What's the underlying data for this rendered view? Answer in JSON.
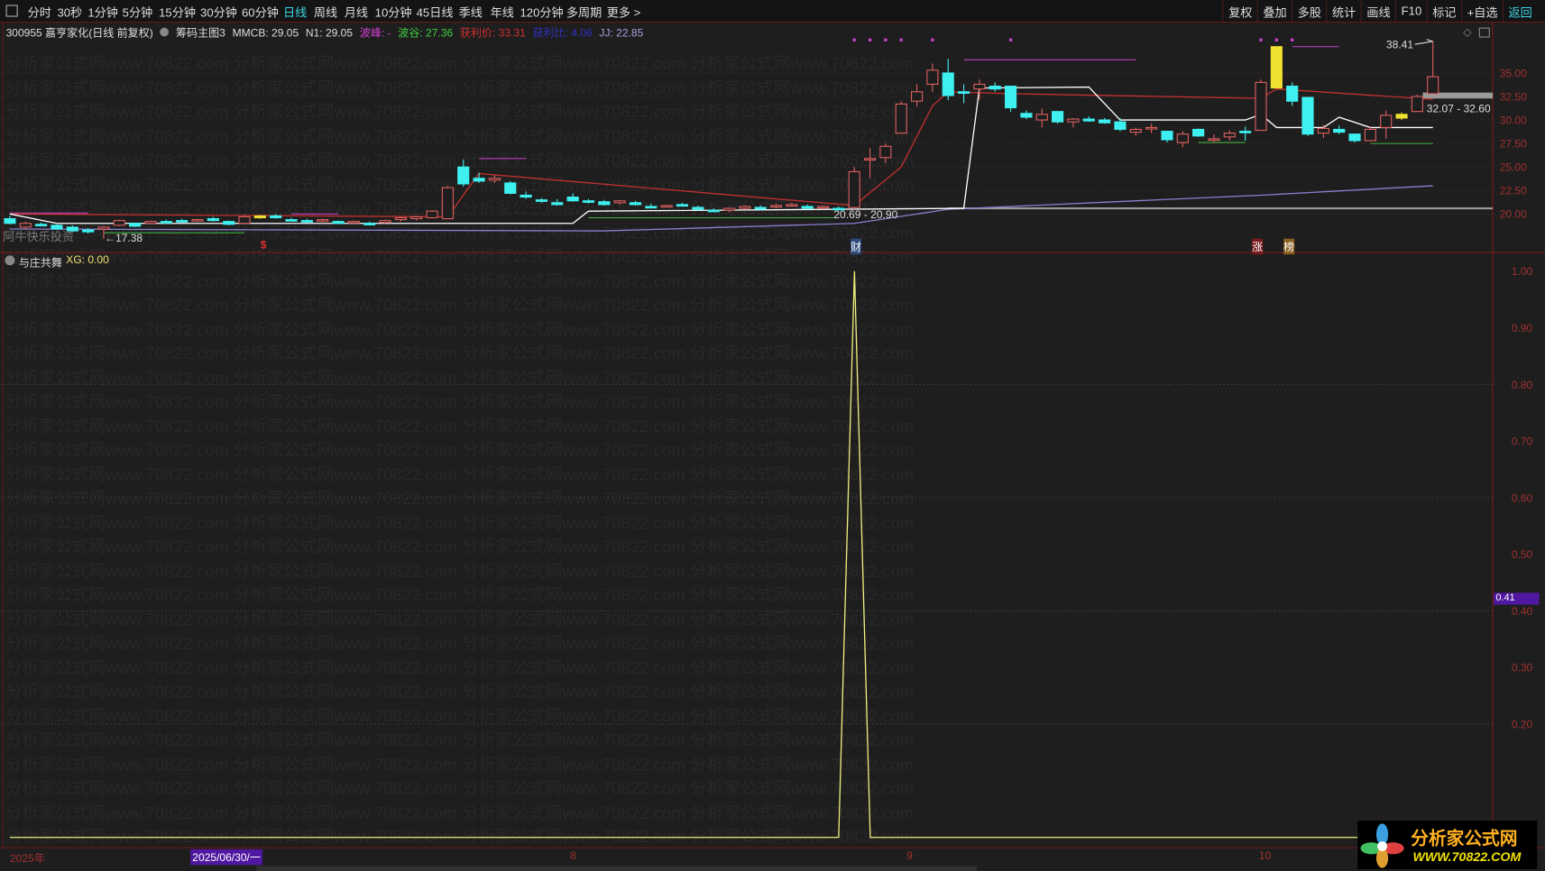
{
  "toolbar": {
    "periods": [
      "分时",
      "30秒",
      "1分钟",
      "5分钟",
      "15分钟",
      "30分钟",
      "60分钟",
      "日线",
      "周线",
      "月线",
      "10分钟",
      "45日线",
      "季线",
      "年线",
      "120分钟",
      "多周期",
      "更多 >"
    ],
    "active": "日线",
    "right": [
      "复权",
      "叠加",
      "多股",
      "统计",
      "画线",
      "F10",
      "标记",
      "+自选",
      "返回"
    ]
  },
  "info": {
    "stock": "300955 嘉亨家化(日线 前复权)",
    "indicator": "筹码主图3",
    "mmcb": "MMCB: 29.05",
    "n1": "N1: 29.05",
    "peak": "波峰: -",
    "valley": "波谷: 27.36",
    "profit_price": "获利价: 33.31",
    "profit_ratio": "获利比: 4.06",
    "jj": "JJ: 22.85"
  },
  "colors": {
    "up": "#e06060",
    "down": "#3ff0f0",
    "ma": "#c03030",
    "line": "#ffffff",
    "avg": "#8a80d0",
    "accent": "#3cd6e6",
    "yellow": "#f0e030"
  },
  "price_axis": [
    "35.00",
    "32.50",
    "30.00",
    "27.50",
    "25.00",
    "22.50",
    "20.00"
  ],
  "price_labels": {
    "low": "←17.38",
    "range1": "20.69 - 20.90",
    "high": "38.41",
    "range2": "32.07 - 32.60",
    "brand": "阿牛快乐投资"
  },
  "markers": {
    "dollar": "$",
    "cai": "财",
    "zhang": "涨",
    "bang": "榜"
  },
  "watermark": "分析家公式网www.70822.com",
  "lower": {
    "title": "与庄共舞",
    "xg": "XG: 0.00",
    "axis": [
      "1.00",
      "0.90",
      "0.80",
      "0.70",
      "0.60",
      "0.50",
      "0.40",
      "0.30",
      "0.20"
    ],
    "current": "0.41"
  },
  "dates": {
    "year": "2025年",
    "cursor": "2025/06/30/一",
    "m8": "8",
    "m9": "9",
    "m10": "10"
  },
  "logo": {
    "cn": "分析家公式网",
    "url": "WWW.70822.COM"
  },
  "chart_data": {
    "type": "candlestick",
    "ohlc": [
      [
        19.5,
        19.8,
        18.9,
        19.0
      ],
      [
        18.6,
        19.2,
        18.4,
        19.0
      ],
      [
        18.9,
        19.1,
        18.7,
        18.8
      ],
      [
        18.8,
        18.9,
        18.3,
        18.4
      ],
      [
        18.6,
        18.8,
        18.1,
        18.2
      ],
      [
        18.3,
        18.5,
        17.9,
        18.1
      ],
      [
        18.4,
        18.7,
        17.38,
        18.6
      ],
      [
        18.8,
        19.4,
        18.7,
        19.3
      ],
      [
        19.0,
        19.1,
        18.6,
        18.7
      ],
      [
        19.0,
        19.3,
        18.9,
        19.2
      ],
      [
        19.2,
        19.4,
        19.0,
        19.1
      ],
      [
        19.3,
        19.5,
        19.1,
        19.2
      ],
      [
        19.3,
        19.5,
        19.2,
        19.4
      ],
      [
        19.5,
        19.7,
        19.2,
        19.3
      ],
      [
        19.2,
        19.3,
        18.8,
        18.9
      ],
      [
        19.0,
        19.9,
        18.9,
        19.7
      ],
      [
        19.6,
        19.9,
        19.5,
        19.8
      ],
      [
        19.8,
        20.0,
        19.5,
        19.6
      ],
      [
        19.4,
        19.6,
        19.2,
        19.3
      ],
      [
        19.3,
        19.5,
        19.1,
        19.2
      ],
      [
        19.3,
        19.5,
        19.0,
        19.4
      ],
      [
        19.2,
        19.3,
        18.9,
        19.0
      ],
      [
        19.1,
        19.3,
        18.9,
        19.2
      ],
      [
        19.0,
        19.2,
        18.8,
        18.9
      ],
      [
        19.1,
        19.4,
        18.9,
        19.3
      ],
      [
        19.4,
        19.7,
        19.2,
        19.6
      ],
      [
        19.5,
        19.8,
        19.3,
        19.7
      ],
      [
        19.6,
        20.4,
        19.5,
        20.3
      ],
      [
        19.5,
        23.0,
        19.5,
        22.8
      ],
      [
        25.0,
        25.8,
        22.9,
        23.2
      ],
      [
        23.8,
        24.4,
        23.3,
        23.5
      ],
      [
        23.6,
        24.1,
        23.3,
        23.8
      ],
      [
        23.3,
        23.5,
        22.1,
        22.2
      ],
      [
        22.0,
        22.4,
        21.6,
        21.8
      ],
      [
        21.5,
        21.7,
        21.2,
        21.4
      ],
      [
        21.2,
        21.6,
        20.9,
        21.0
      ],
      [
        21.8,
        22.2,
        21.3,
        21.4
      ],
      [
        21.4,
        21.6,
        21.1,
        21.3
      ],
      [
        21.3,
        21.5,
        20.9,
        21.0
      ],
      [
        21.2,
        21.5,
        21.0,
        21.4
      ],
      [
        21.2,
        21.4,
        20.9,
        21.0
      ],
      [
        20.8,
        21.1,
        20.6,
        20.7
      ],
      [
        20.8,
        21.0,
        20.7,
        20.9
      ],
      [
        21.0,
        21.2,
        20.8,
        20.9
      ],
      [
        20.7,
        20.9,
        20.4,
        20.5
      ],
      [
        20.4,
        20.6,
        20.2,
        20.3
      ],
      [
        20.4,
        20.7,
        20.2,
        20.6
      ],
      [
        20.6,
        20.9,
        20.5,
        20.8
      ],
      [
        20.7,
        20.9,
        20.4,
        20.6
      ],
      [
        20.8,
        21.1,
        20.6,
        20.9
      ],
      [
        20.9,
        21.2,
        20.8,
        21.0
      ],
      [
        20.8,
        21.0,
        20.5,
        20.6
      ],
      [
        20.7,
        20.9,
        20.5,
        20.8
      ],
      [
        20.6,
        20.8,
        20.4,
        20.5
      ],
      [
        20.69,
        25.0,
        20.5,
        24.5
      ],
      [
        25.8,
        27.0,
        23.8,
        25.9
      ],
      [
        26.0,
        27.5,
        25.4,
        27.2
      ],
      [
        28.6,
        32.0,
        28.6,
        31.7
      ],
      [
        32.0,
        33.8,
        31.4,
        33.0
      ],
      [
        33.8,
        36.0,
        33.0,
        35.3
      ],
      [
        35.0,
        36.5,
        32.1,
        32.6
      ],
      [
        33.0,
        33.8,
        31.8,
        32.9
      ],
      [
        33.3,
        34.3,
        32.1,
        33.8
      ],
      [
        33.6,
        34.0,
        33.0,
        33.3
      ],
      [
        33.6,
        33.6,
        30.9,
        31.3
      ],
      [
        30.7,
        31.0,
        30.1,
        30.3
      ],
      [
        30.0,
        31.2,
        29.2,
        30.6
      ],
      [
        30.9,
        30.9,
        29.6,
        29.8
      ],
      [
        29.8,
        30.2,
        29.2,
        30.1
      ],
      [
        30.1,
        30.4,
        29.8,
        29.9
      ],
      [
        30.0,
        30.2,
        29.6,
        29.7
      ],
      [
        29.8,
        30.2,
        28.8,
        29.0
      ],
      [
        28.7,
        29.2,
        28.3,
        29.0
      ],
      [
        29.2,
        29.6,
        28.6,
        29.2
      ],
      [
        28.8,
        28.8,
        27.6,
        27.9
      ],
      [
        27.6,
        28.8,
        27.1,
        28.5
      ],
      [
        29.0,
        29.1,
        28.2,
        28.3
      ],
      [
        27.9,
        28.5,
        27.6,
        28.0
      ],
      [
        28.2,
        28.9,
        27.8,
        28.6
      ],
      [
        28.8,
        29.3,
        27.8,
        28.7
      ],
      [
        28.9,
        34.3,
        28.9,
        34.0
      ],
      [
        37.8,
        37.8,
        33.4,
        33.4
      ],
      [
        33.6,
        34.0,
        31.5,
        32.0
      ],
      [
        32.4,
        32.4,
        28.3,
        28.5
      ],
      [
        28.6,
        29.5,
        28.1,
        29.1
      ],
      [
        29.0,
        29.4,
        28.5,
        28.7
      ],
      [
        28.5,
        28.5,
        27.6,
        27.8
      ],
      [
        27.8,
        29.3,
        27.8,
        29.0
      ],
      [
        29.2,
        31.0,
        28.0,
        30.5
      ],
      [
        30.2,
        30.8,
        30.0,
        30.6
      ],
      [
        30.9,
        32.7,
        30.9,
        32.5
      ],
      [
        32.8,
        38.41,
        32.8,
        34.6
      ]
    ],
    "yellow_candles": [
      16,
      81,
      89
    ],
    "ma_line": [
      [
        0,
        20
      ],
      [
        28,
        19.7
      ],
      [
        30,
        24.3
      ],
      [
        54,
        20.9
      ],
      [
        57,
        25
      ],
      [
        59,
        31.5
      ],
      [
        60,
        33
      ],
      [
        64,
        32.8
      ],
      [
        80,
        32.3
      ],
      [
        81,
        33.3
      ],
      [
        91,
        32.2
      ]
    ],
    "white_line": [
      [
        0,
        20
      ],
      [
        3,
        19
      ],
      [
        36,
        19
      ],
      [
        37,
        20.3
      ],
      [
        61,
        20.6
      ],
      [
        62,
        33.4
      ],
      [
        69,
        33.5
      ],
      [
        71,
        30.0
      ],
      [
        79,
        30.0
      ],
      [
        80,
        30.6
      ],
      [
        81,
        29.2
      ],
      [
        84,
        29.2
      ],
      [
        85,
        30.3
      ],
      [
        87,
        29.2
      ],
      [
        91,
        29.2
      ]
    ],
    "avg_line": [
      [
        0,
        18.4
      ],
      [
        38,
        18.2
      ],
      [
        54,
        19.0
      ],
      [
        60,
        20.5
      ],
      [
        80,
        22
      ],
      [
        91,
        23.0
      ]
    ],
    "green_levels": [
      [
        6,
        15,
        18.0
      ],
      [
        37,
        53,
        19.6
      ],
      [
        76,
        79,
        27.6
      ],
      [
        87,
        91,
        27.5
      ]
    ],
    "purple_levels": [
      [
        0,
        5,
        20.1
      ],
      [
        18,
        21,
        20.0
      ],
      [
        30,
        33,
        25.9
      ],
      [
        61,
        72,
        36.4
      ],
      [
        82,
        85,
        37.8
      ]
    ],
    "signal_dots": [
      54,
      55,
      56,
      57,
      59,
      64,
      80,
      81,
      82
    ],
    "price_ylim": [
      17,
      38.5
    ],
    "xg_series": {
      "spike_index": 53,
      "spike_value": 1.0,
      "baseline": 0.0,
      "ylim": [
        0,
        1
      ]
    }
  }
}
